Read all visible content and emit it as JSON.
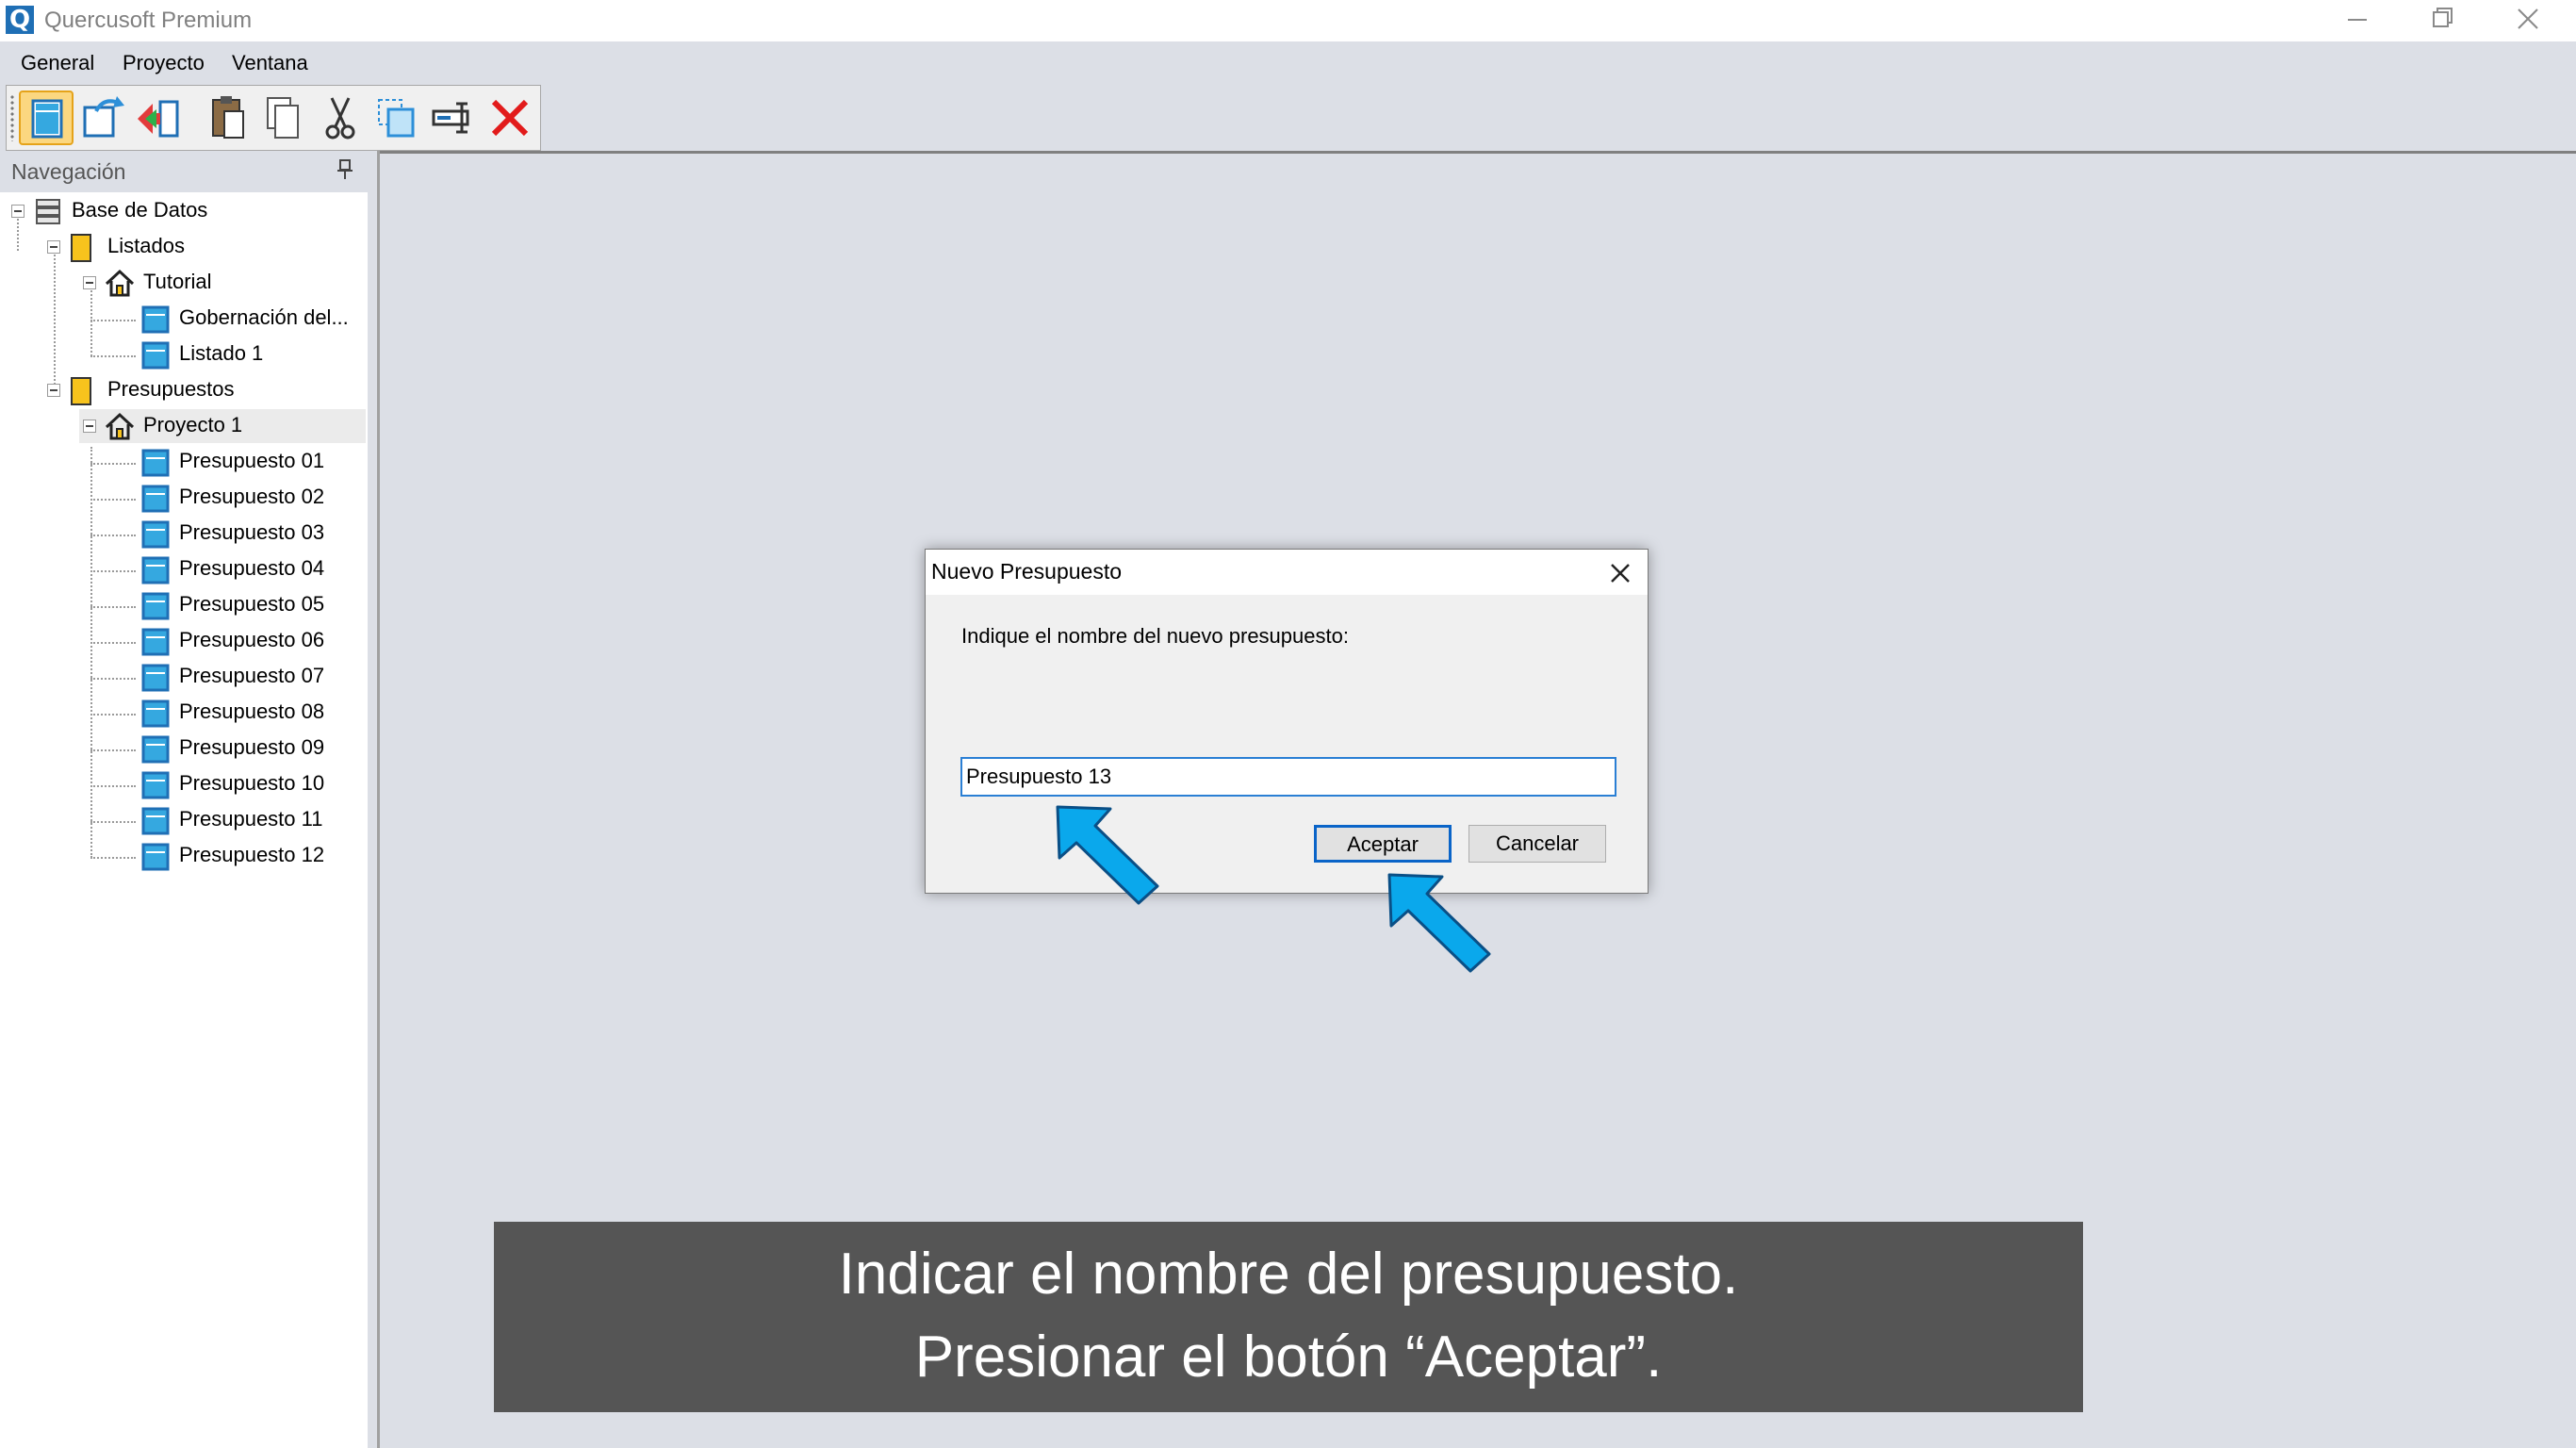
{
  "window": {
    "logo_letter": "Q",
    "title": "Quercusoft Premium",
    "controls": [
      "minimize-icon",
      "restore-icon",
      "close-icon"
    ]
  },
  "menu": {
    "items": [
      "General",
      "Proyecto",
      "Ventana"
    ]
  },
  "toolbar": {
    "icons": [
      "new-document-icon",
      "undo-icon",
      "import-icon",
      "paste-icon",
      "copy-icon",
      "cut-icon",
      "duplicate-icon",
      "rename-icon",
      "delete-icon"
    ]
  },
  "navigation": {
    "title": "Navegación",
    "tree": {
      "root": "Base de Datos",
      "listados": {
        "label": "Listados",
        "tutorial": "Tutorial",
        "items": [
          "Gobernación del...",
          "Listado 1"
        ]
      },
      "presupuestos": {
        "label": "Presupuestos",
        "project": "Proyecto 1",
        "items": [
          "Presupuesto 01",
          "Presupuesto 02",
          "Presupuesto 03",
          "Presupuesto 04",
          "Presupuesto 05",
          "Presupuesto 06",
          "Presupuesto 07",
          "Presupuesto 08",
          "Presupuesto 09",
          "Presupuesto 10",
          "Presupuesto 11",
          "Presupuesto 12"
        ]
      }
    }
  },
  "dialog": {
    "title": "Nuevo Presupuesto",
    "prompt": "Indique el nombre del nuevo presupuesto:",
    "input_value": "Presupuesto 13",
    "ok_label": "Aceptar",
    "cancel_label": "Cancelar"
  },
  "caption": {
    "line1": "Indicar el nombre del presupuesto.",
    "line2": "Presionar el botón “Aceptar”."
  },
  "colors": {
    "accent_arrow": "#0aa8ec",
    "caption_bg": "#555555",
    "workspace_bg": "#dcdfe6"
  }
}
